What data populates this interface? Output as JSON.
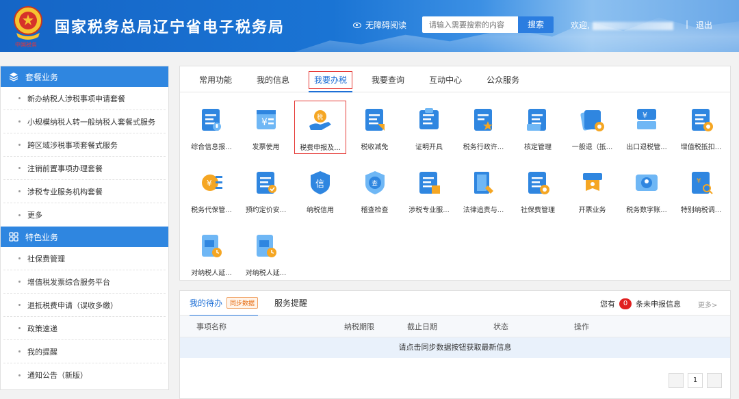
{
  "header": {
    "emblem_subtitle": "中国税务",
    "title": "国家税务总局辽宁省电子税务局",
    "accessibility": "无障碍阅读",
    "search_placeholder": "请输入需要搜索的内容",
    "search_button": "搜索",
    "welcome": "欢迎,",
    "separator": "|",
    "logout": "退出"
  },
  "sidebar": {
    "section1_title": "套餐业务",
    "section1_items": [
      "新办纳税人涉税事项申请套餐",
      "小规模纳税人转一般纳税人套餐式服务",
      "跨区域涉税事项套餐式服务",
      "注销前置事项办理套餐",
      "涉税专业服务机构套餐",
      "更多"
    ],
    "section2_title": "特色业务",
    "section2_items": [
      "社保费管理",
      "增值税发票综合服务平台",
      "退抵税费申请（误收多缴）",
      "政策速递",
      "我的提醒",
      "通知公告（新版）"
    ]
  },
  "tabs": [
    "常用功能",
    "我的信息",
    "我要办税",
    "我要查询",
    "互动中心",
    "公众服务"
  ],
  "active_tab": "我要办税",
  "functions": [
    {
      "label": "综合信息报...",
      "icon": "document-mic-icon"
    },
    {
      "label": "发票使用",
      "icon": "invoice-icon"
    },
    {
      "label": "税费申报及...",
      "icon": "tax-declaration-icon",
      "highlighted": true
    },
    {
      "label": "税收减免",
      "icon": "tax-reduction-icon"
    },
    {
      "label": "证明开具",
      "icon": "certificate-icon"
    },
    {
      "label": "税务行政许...",
      "icon": "admin-permit-icon"
    },
    {
      "label": "核定管理",
      "icon": "approval-mgmt-icon"
    },
    {
      "label": "一般退（抵...",
      "icon": "refund-icon"
    },
    {
      "label": "出口退税管...",
      "icon": "export-refund-icon"
    },
    {
      "label": "增值税抵扣...",
      "icon": "vat-deduction-icon"
    },
    {
      "label": "税务代保管...",
      "icon": "custody-icon"
    },
    {
      "label": "预约定价安...",
      "icon": "pricing-arrangement-icon"
    },
    {
      "label": "纳税信用",
      "icon": "credit-icon"
    },
    {
      "label": "稽查检查",
      "icon": "inspection-icon"
    },
    {
      "label": "涉税专业服...",
      "icon": "professional-service-icon"
    },
    {
      "label": "法律追责与...",
      "icon": "legal-icon"
    },
    {
      "label": "社保费管理",
      "icon": "social-security-icon"
    },
    {
      "label": "开票业务",
      "icon": "invoicing-icon"
    },
    {
      "label": "税务数字账...",
      "icon": "digital-account-icon"
    },
    {
      "label": "特别纳税调...",
      "icon": "special-adjust-icon"
    },
    {
      "label": "对纳税人延...",
      "icon": "extension-icon"
    },
    {
      "label": "对纳税人延...",
      "icon": "extension-icon"
    }
  ],
  "todo": {
    "tab1": "我的待办",
    "sync_label": "同步数据",
    "tab2": "服务提醒",
    "notice_prefix": "您有",
    "notice_count": "0",
    "notice_suffix": "条未申报信息",
    "more": "更多>",
    "columns": [
      "事项名称",
      "纳税期限",
      "截止日期",
      "状态",
      "操作"
    ],
    "empty_message": "请点击同步数据按钮获取最新信息",
    "page": "1"
  },
  "colors": {
    "primary": "#2f86e0",
    "highlight": "#e53935"
  }
}
